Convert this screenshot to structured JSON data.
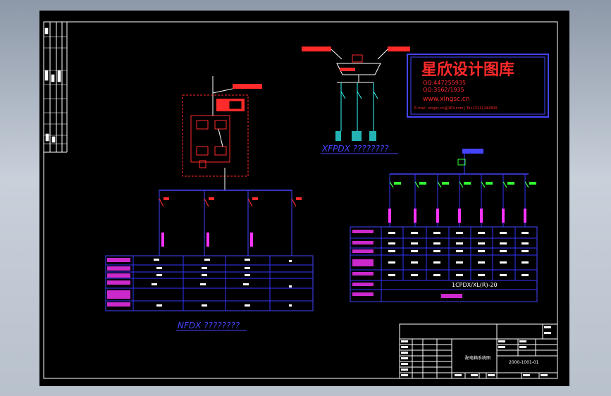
{
  "watermark": {
    "title": "星欣设计图库",
    "qq1": "QQ:447255935",
    "qq2": "QQ:3562/1935",
    "url": "www.xingsc.cn",
    "contact": "E-mail: xingsc.cn@163.com | Tel:13111142800"
  },
  "captions": {
    "xfpdx": "XFPDX ????????",
    "left": "NFDX ????????",
    "right_code": "1CPDX/XL(R)-20"
  },
  "title_block": {
    "drawing_name": "配电箱系统图",
    "drawing_no": "2000-1001-01"
  },
  "colors": {
    "frame": "#ffffff",
    "table": "#3333ff",
    "red": "#ff2a2a",
    "magenta": "#ff33ff",
    "green": "#33ff33",
    "cyan": "#33ffff",
    "blue": "#4444ff"
  }
}
